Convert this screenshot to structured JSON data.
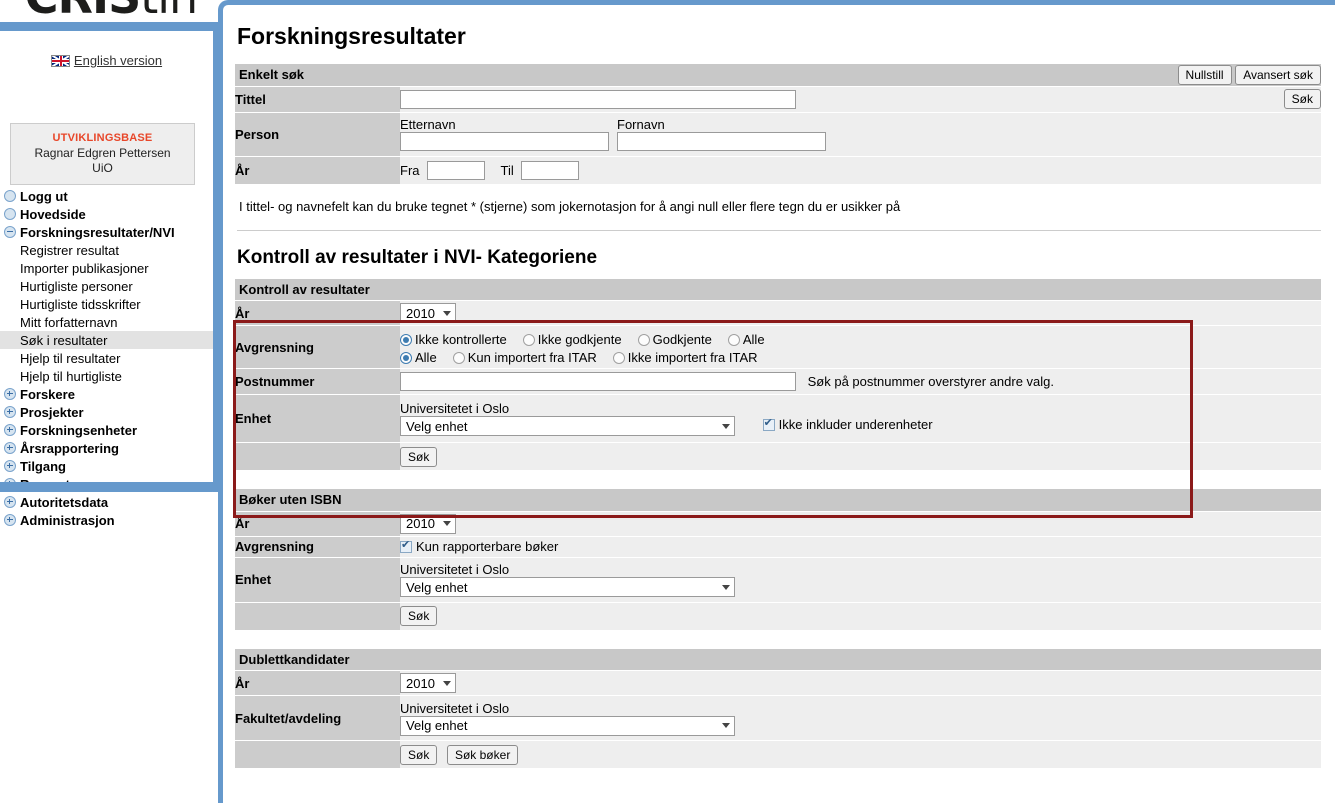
{
  "branding": {
    "logo_main": "CRIS",
    "logo_suffix": "tin",
    "english_link": "English version",
    "flag_icon": "uk-flag-icon"
  },
  "user_box": {
    "title": "UTVIKLINGSBASE",
    "name": "Ragnar Edgren Pettersen",
    "org": "UiO"
  },
  "sidebar": {
    "items": [
      {
        "label": "Logg ut",
        "level": "top",
        "icon": "circle-icon",
        "selected": false
      },
      {
        "label": "Hovedside",
        "level": "top",
        "icon": "circle-icon",
        "selected": false
      },
      {
        "label": "Forskningsresultater/NVI",
        "level": "top",
        "icon": "minus-icon",
        "selected": false
      },
      {
        "label": "Registrer resultat",
        "level": "child",
        "icon": "",
        "selected": false
      },
      {
        "label": "Importer publikasjoner",
        "level": "child",
        "icon": "",
        "selected": false
      },
      {
        "label": "Hurtigliste personer",
        "level": "child",
        "icon": "",
        "selected": false
      },
      {
        "label": "Hurtigliste tidsskrifter",
        "level": "child",
        "icon": "",
        "selected": false
      },
      {
        "label": "Mitt forfatternavn",
        "level": "child",
        "icon": "",
        "selected": false
      },
      {
        "label": "Søk i resultater",
        "level": "child",
        "icon": "",
        "selected": true
      },
      {
        "label": "Hjelp til resultater",
        "level": "child",
        "icon": "",
        "selected": false
      },
      {
        "label": "Hjelp til hurtigliste",
        "level": "child",
        "icon": "",
        "selected": false
      },
      {
        "label": "Forskere",
        "level": "top",
        "icon": "plus-icon",
        "selected": false
      },
      {
        "label": "Prosjekter",
        "level": "top",
        "icon": "plus-icon",
        "selected": false
      },
      {
        "label": "Forskningsenheter",
        "level": "top",
        "icon": "plus-icon",
        "selected": false
      },
      {
        "label": "Årsrapportering",
        "level": "top",
        "icon": "plus-icon",
        "selected": false
      },
      {
        "label": "Tilgang",
        "level": "top",
        "icon": "plus-icon",
        "selected": false
      },
      {
        "label": "Rapporter",
        "level": "top",
        "icon": "plus-icon",
        "selected": false
      },
      {
        "label": "Autoritetsdata",
        "level": "top",
        "icon": "plus-icon",
        "selected": false
      },
      {
        "label": "Administrasjon",
        "level": "top",
        "icon": "plus-icon",
        "selected": false
      }
    ]
  },
  "page": {
    "title": "Forskningsresultater"
  },
  "simple_search": {
    "header": "Enkelt søk",
    "reset_label": "Nullstill",
    "advanced_label": "Avansert søk",
    "search_label": "Søk",
    "title_label": "Tittel",
    "title_value": "",
    "person_label": "Person",
    "lastname_label": "Etternavn",
    "lastname_value": "",
    "firstname_label": "Fornavn",
    "firstname_value": "",
    "year_label": "År",
    "from_label": "Fra",
    "from_value": "",
    "to_label": "Til",
    "to_value": "",
    "help_text": "I tittel- og navnefelt kan du bruke tegnet * (stjerne) som jokernotasjon for å angi null eller flere tegn du er usikker på"
  },
  "nvi_section": {
    "title": "Kontroll av resultater i NVI- Kategoriene",
    "header": "Kontroll av resultater",
    "year_label": "År",
    "year_value": "2010",
    "limit_label": "Avgrensning",
    "radios_row1": [
      {
        "label": "Ikke kontrollerte",
        "selected": true
      },
      {
        "label": "Ikke godkjente",
        "selected": false
      },
      {
        "label": "Godkjente",
        "selected": false
      },
      {
        "label": "Alle",
        "selected": false
      }
    ],
    "radios_row2": [
      {
        "label": "Alle",
        "selected": true
      },
      {
        "label": "Kun importert fra ITAR",
        "selected": false
      },
      {
        "label": "Ikke importert fra ITAR",
        "selected": false
      }
    ],
    "postcode_label": "Postnummer",
    "postcode_value": "",
    "postcode_note": "Søk på postnummer overstyrer andre valg.",
    "unit_label": "Enhet",
    "unit_org": "Universitetet i Oslo",
    "unit_select_value": "Velg enhet",
    "exclude_sub_label": "Ikke inkluder underenheter",
    "exclude_sub_checked": true,
    "search_label": "Søk",
    "highlight_color": "#8b1a1a"
  },
  "books_section": {
    "header": "Bøker uten ISBN",
    "year_label": "År",
    "year_value": "2010",
    "limit_label": "Avgrensning",
    "reportable_label": "Kun rapporterbare bøker",
    "reportable_checked": true,
    "unit_label": "Enhet",
    "unit_org": "Universitetet i Oslo",
    "unit_select_value": "Velg enhet",
    "search_label": "Søk"
  },
  "duplicates_section": {
    "header": "Dublettkandidater",
    "year_label": "År",
    "year_value": "2010",
    "faculty_label": "Fakultet/avdeling",
    "faculty_org": "Universitetet i Oslo",
    "faculty_select_value": "Velg enhet",
    "search_label": "Søk",
    "search_books_label": "Søk bøker"
  }
}
